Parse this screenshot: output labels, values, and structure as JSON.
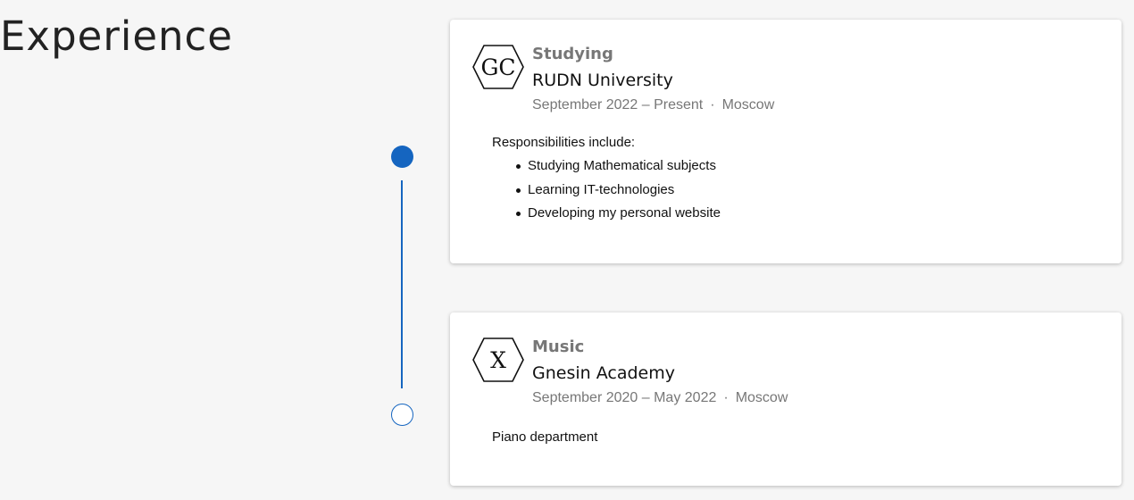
{
  "section": {
    "title": "Experience"
  },
  "timeline": {
    "accent_color": "#1565c0"
  },
  "experiences": [
    {
      "logo_text": "GC",
      "logo_icon": "hexagon-logo-icon",
      "category": "Studying",
      "organization": "RUDN University",
      "dates": "September 2022 – Present",
      "separator": "·",
      "location": "Moscow",
      "intro": "Responsibilities include:",
      "items": [
        "Studying Mathematical subjects",
        "Learning IT-technologies",
        "Developing my personal website"
      ]
    },
    {
      "logo_text": "X",
      "logo_icon": "hexagon-logo-icon",
      "category": "Music",
      "organization": "Gnesin Academy",
      "dates": "September 2020 – May 2022",
      "separator": "·",
      "location": "Moscow",
      "intro": "Piano department"
    }
  ]
}
